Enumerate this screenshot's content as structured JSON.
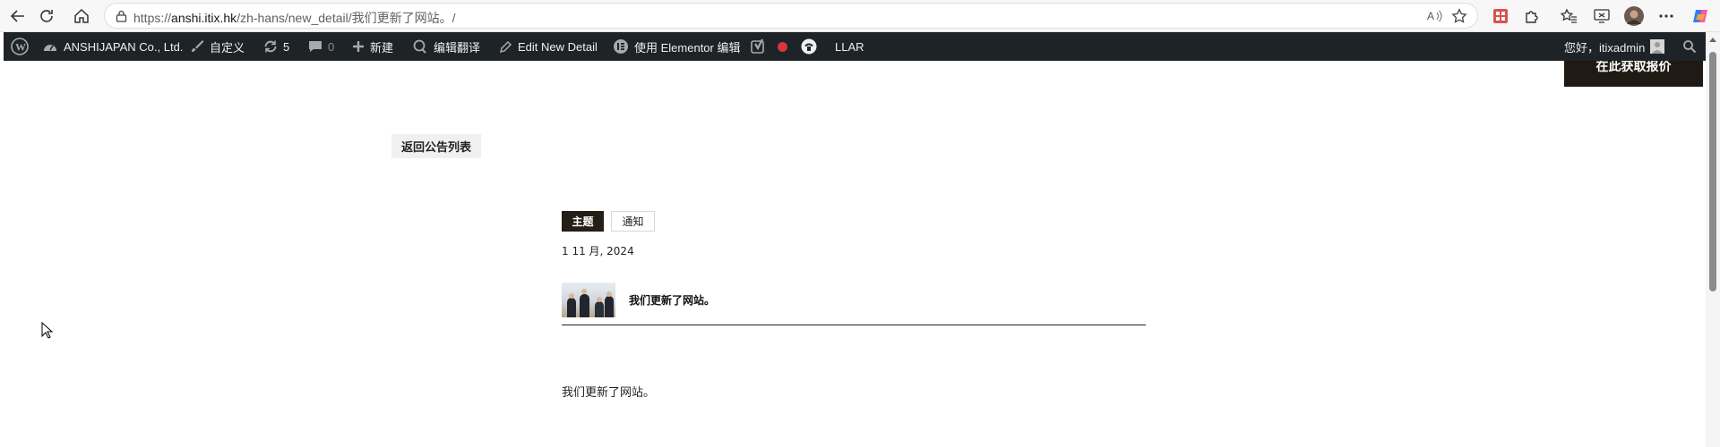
{
  "browser": {
    "url_prefix": "https://",
    "url_domain": "anshi.itix.hk",
    "url_path": "/zh-hans/new_detail/我们更新了网站。/",
    "icons": [
      "back-icon",
      "refresh-icon",
      "home-icon",
      "lock-icon",
      "read-aloud-icon",
      "favorite-star-icon",
      "extension-red-icon",
      "extensions-puzzle-icon",
      "favorites-icon",
      "screen-icon",
      "profile-avatar",
      "more-icon",
      "copilot-icon"
    ]
  },
  "adminbar": {
    "site_name": "ANSHIJAPAN Co., Ltd.",
    "customize": "自定义",
    "updates_count": "5",
    "comments_count": "0",
    "new": "新建",
    "edit_translation": "编辑翻译",
    "edit_post": "Edit New Detail",
    "elementor": "使用 Elementor 编辑",
    "llar": "LLAR",
    "greeting": "您好，itixadmin"
  },
  "page": {
    "cta_label": "在此获取报价",
    "back_button": "返回公告列表",
    "tags": [
      "主题",
      "通知"
    ],
    "date": "1 11 月, 2024",
    "post_title": "我们更新了网站。",
    "post_body": "我们更新了网站。"
  },
  "colors": {
    "adminbar_bg": "#1d2327",
    "tag_primary_bg": "#231e16",
    "cta_bg": "#1f1a13",
    "status_dot": "#d63638"
  }
}
